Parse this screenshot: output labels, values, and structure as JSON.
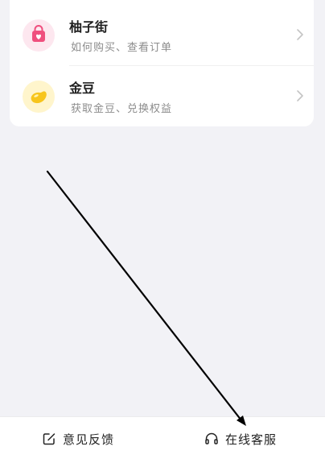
{
  "menu": {
    "items": [
      {
        "title": "柚子街",
        "subtitle": "如何购买、查看订单",
        "icon": "shopping-bag-icon",
        "icon_color": "#ef4f7e"
      },
      {
        "title": "金豆",
        "subtitle": "获取金豆、兑换权益",
        "icon": "golden-bean-icon",
        "icon_color": "#f7c51c"
      }
    ]
  },
  "bottom_bar": {
    "feedback_label": "意见反馈",
    "feedback_icon": "edit-icon",
    "service_label": "在线客服",
    "service_icon": "headset-icon"
  },
  "annotation": {
    "arrow_color": "#000000"
  }
}
